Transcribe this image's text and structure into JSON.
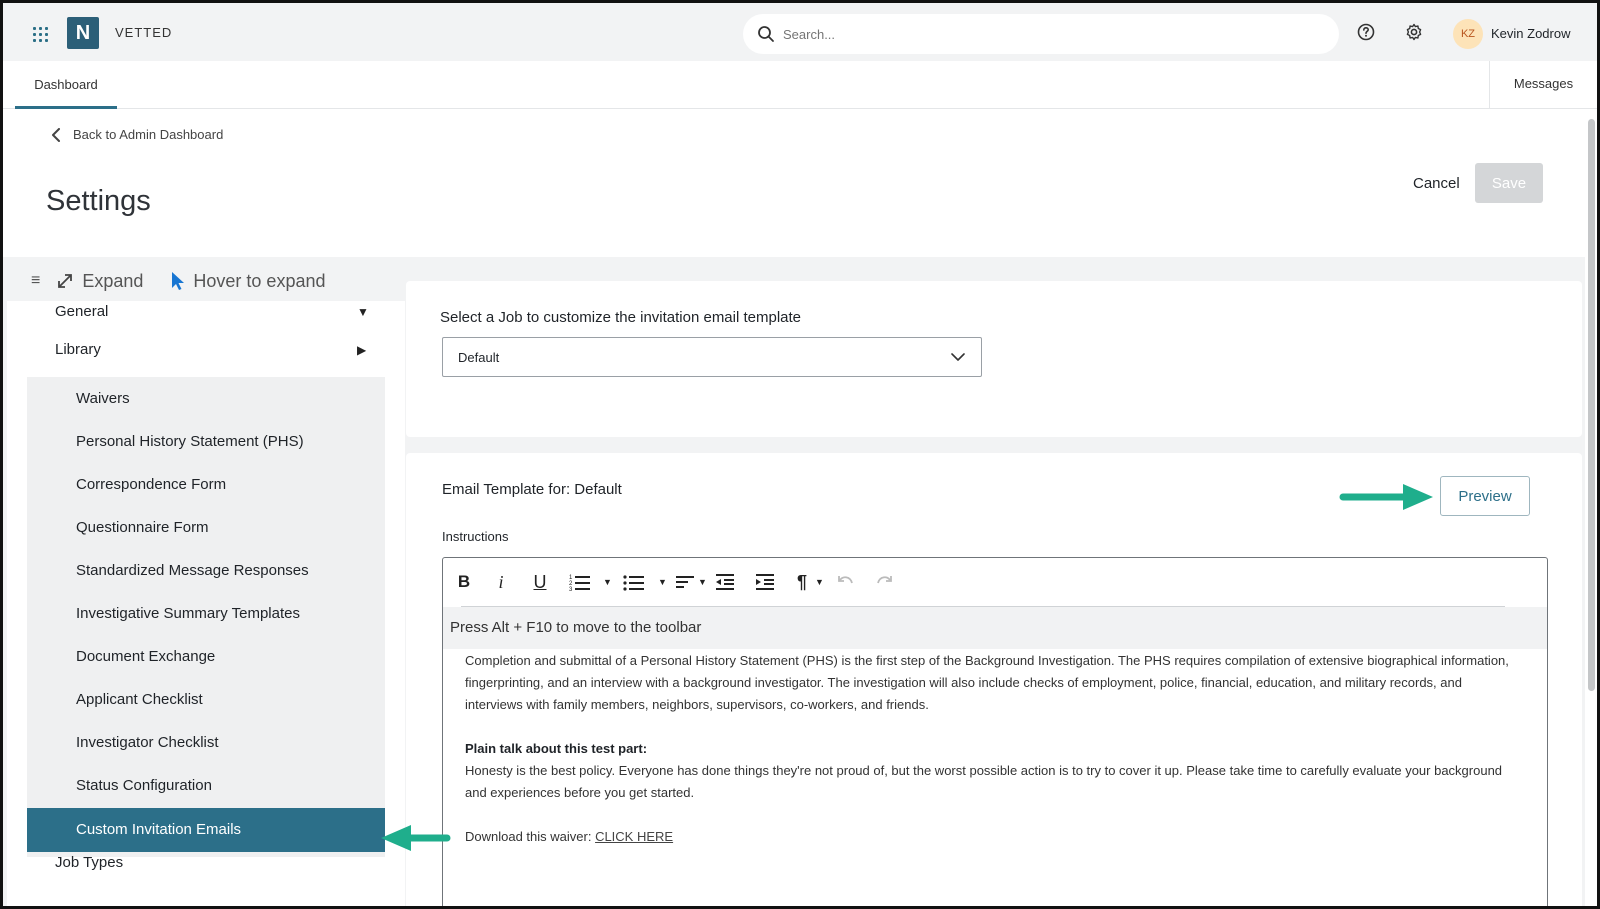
{
  "topbar": {
    "brand": "VETTED",
    "logo_letter": "N",
    "search_placeholder": "Search...",
    "user_initials": "KZ",
    "user_name": "Kevin Zodrow"
  },
  "tabs": {
    "dashboard": "Dashboard",
    "messages": "Messages"
  },
  "header": {
    "back_link": "Back to Admin Dashboard",
    "title": "Settings",
    "cancel_label": "Cancel",
    "save_label": "Save"
  },
  "sidebar": {
    "expand_label": "Expand",
    "hover_label": "Hover to expand",
    "general": "General",
    "library": "Library",
    "items": [
      "Waivers",
      "Personal History Statement (PHS)",
      "Correspondence Form",
      "Questionnaire Form",
      "Standardized Message Responses",
      "Investigative Summary Templates",
      "Document Exchange",
      "Applicant Checklist",
      "Investigator Checklist",
      "Status Configuration",
      "Custom Invitation Emails"
    ],
    "active_item": "Custom Invitation Emails",
    "job_types": "Job Types"
  },
  "job_card": {
    "label": "Select a Job to customize the invitation email template",
    "selected_job": "Default"
  },
  "template_card": {
    "title": "Email Template for: Default",
    "preview_label": "Preview",
    "instructions_label": "Instructions",
    "toolbar_hint": "Press Alt + F10 to move to the toolbar",
    "body": {
      "paragraph1": "Completion and submittal of a Personal History Statement (PHS) is the first step of the Background Investigation. The PHS requires compilation of extensive biographical information, fingerprinting, and an interview with a background investigator. The investigation will also include checks of employment, police, financial, education, and military records, and interviews with family members, neighbors, supervisors, co-workers, and friends.",
      "heading": "Plain talk about this test part:",
      "paragraph2": "Honesty is the best policy. Everyone has done things they're not proud of, but the worst possible action is to try to cover it up. Please take time to carefully evaluate your background and experiences before you get started.",
      "download_text": "Download this waiver: ",
      "download_link": "CLICK HERE"
    }
  },
  "colors": {
    "accent": "#2c6f89",
    "annotation_arrow": "#1fae8c",
    "save_disabled": "#d4d6d8"
  }
}
